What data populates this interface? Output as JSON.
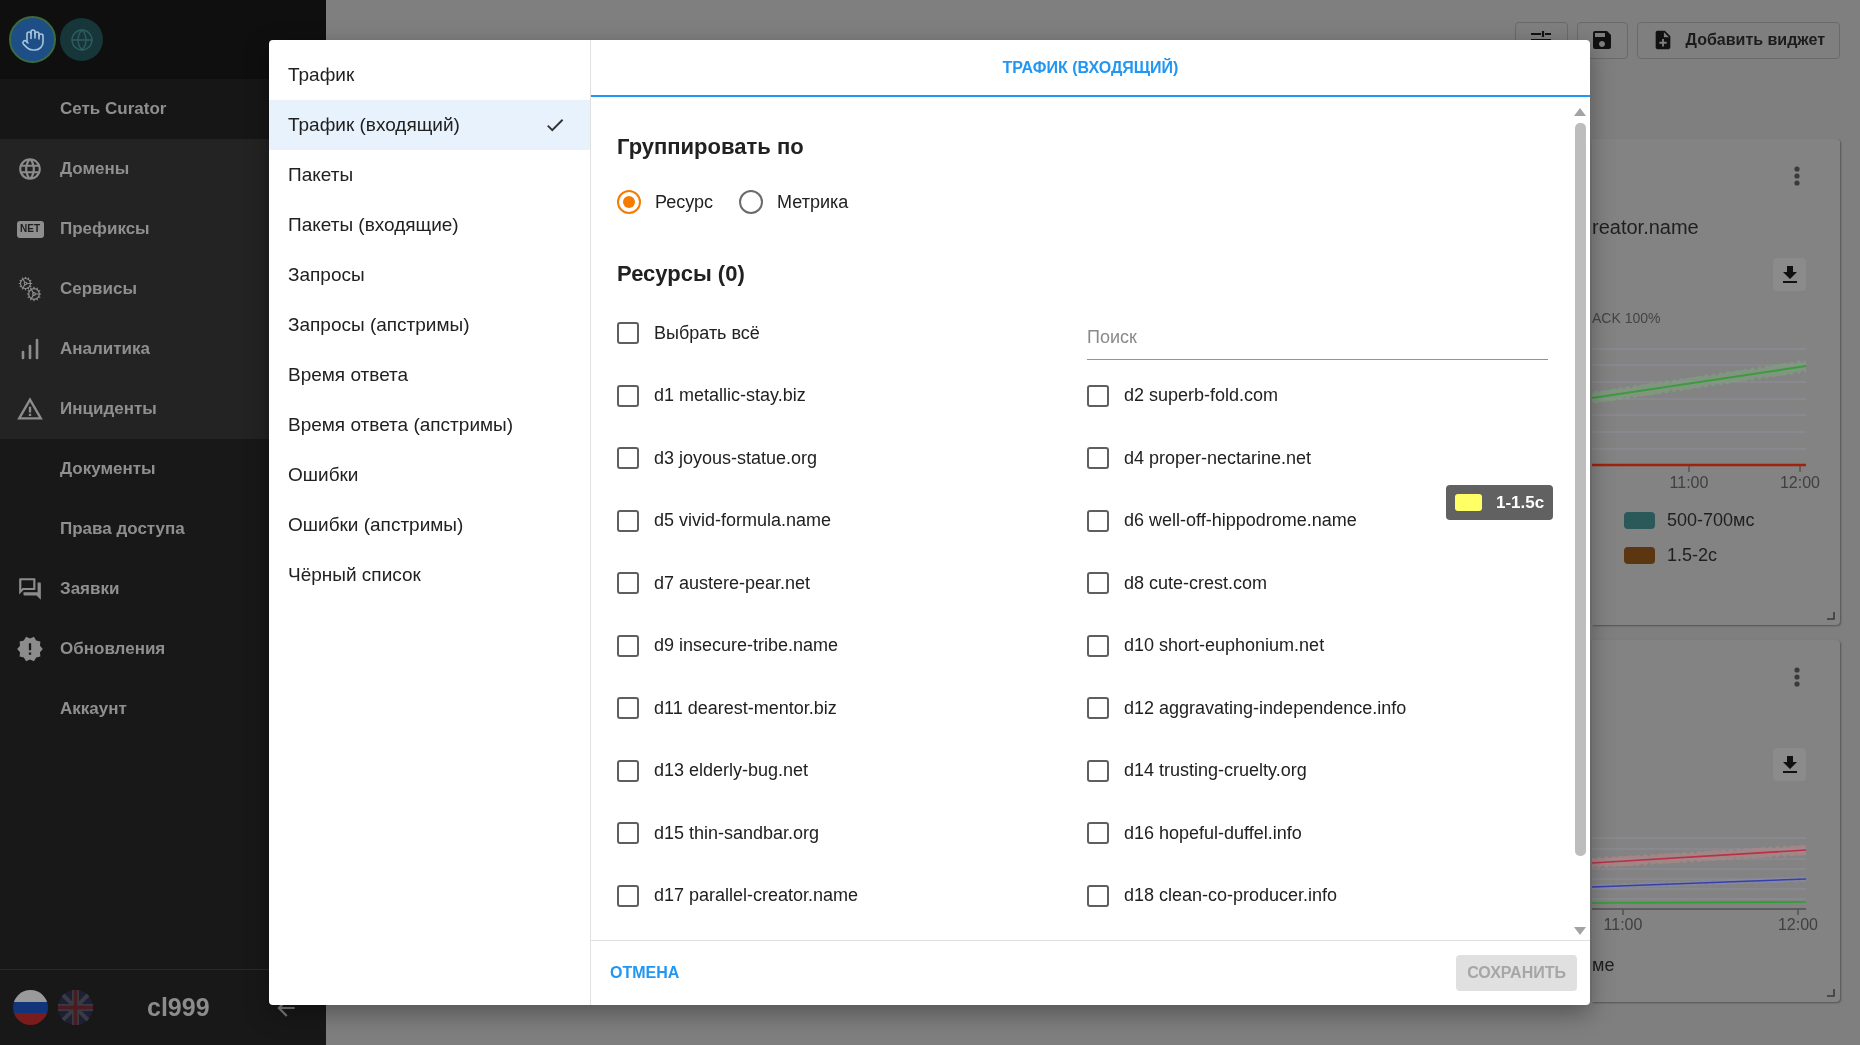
{
  "sidebar": {
    "items": [
      {
        "label": "Сеть Curator",
        "children": [
          {
            "label": "Домены"
          },
          {
            "label": "Префиксы",
            "icon_text": "NET"
          },
          {
            "label": "Сервисы"
          },
          {
            "label": "Аналитика"
          },
          {
            "label": "Инциденты"
          }
        ]
      },
      {
        "label": "Документы"
      },
      {
        "label": "Права доступа"
      },
      {
        "label": "Заявки"
      },
      {
        "label": "Обновления"
      },
      {
        "label": "Аккаунт"
      }
    ],
    "user": "cl999"
  },
  "header": {
    "add_widget": "Добавить виджет"
  },
  "widgets": [
    {
      "title": "reator.name",
      "subtitle": "ACK 100%",
      "x_labels": [
        "11:00",
        "12:00"
      ],
      "legend": [
        {
          "label": "500-700мс",
          "color": "#2b5959"
        },
        {
          "label": "1.5-2с",
          "color": "#5c3511"
        }
      ]
    },
    {
      "x_labels": [
        "11:00",
        "12:00"
      ],
      "footer": "ме"
    }
  ],
  "tooltip": {
    "label": "1-1.5с",
    "color": "#ffff66"
  },
  "dialog": {
    "menu": [
      {
        "label": "Трафик",
        "selected": false
      },
      {
        "label": "Трафик (входящий)",
        "selected": true
      },
      {
        "label": "Пакеты",
        "selected": false
      },
      {
        "label": "Пакеты (входящие)",
        "selected": false
      },
      {
        "label": "Запросы",
        "selected": false
      },
      {
        "label": "Запросы (апстримы)",
        "selected": false
      },
      {
        "label": "Время ответа",
        "selected": false
      },
      {
        "label": "Время ответа (апстримы)",
        "selected": false
      },
      {
        "label": "Ошибки",
        "selected": false
      },
      {
        "label": "Ошибки (апстримы)",
        "selected": false
      },
      {
        "label": "Чёрный список",
        "selected": false
      }
    ],
    "title": "ТРАФИК (ВХОДЯЩИЙ)",
    "group_by": {
      "label": "Группировать по",
      "options": [
        {
          "label": "Ресурс",
          "selected": true
        },
        {
          "label": "Метрика",
          "selected": false
        }
      ]
    },
    "resources": {
      "heading": "Ресурсы (0)",
      "select_all": {
        "label": "Выбрать всё",
        "checked": false
      },
      "search": {
        "placeholder": "Поиск"
      },
      "items": [
        {
          "label": "d1 metallic-stay.biz",
          "checked": false
        },
        {
          "label": "d2 superb-fold.com",
          "checked": false
        },
        {
          "label": "d3 joyous-statue.org",
          "checked": false
        },
        {
          "label": "d4 proper-nectarine.net",
          "checked": false
        },
        {
          "label": "d5 vivid-formula.name",
          "checked": false
        },
        {
          "label": "d6 well-off-hippodrome.name",
          "checked": false
        },
        {
          "label": "d7 austere-pear.net",
          "checked": false
        },
        {
          "label": "d8 cute-crest.com",
          "checked": false
        },
        {
          "label": "d9 insecure-tribe.name",
          "checked": false
        },
        {
          "label": "d10 short-euphonium.net",
          "checked": false
        },
        {
          "label": "d11 dearest-mentor.biz",
          "checked": false
        },
        {
          "label": "d12 aggravating-independence.info",
          "checked": false
        },
        {
          "label": "d13 elderly-bug.net",
          "checked": false
        },
        {
          "label": "d14 trusting-cruelty.org",
          "checked": false
        },
        {
          "label": "d15 thin-sandbar.org",
          "checked": false
        },
        {
          "label": "d16 hopeful-duffel.info",
          "checked": false
        },
        {
          "label": "d17 parallel-creator.name",
          "checked": false
        },
        {
          "label": "d18 clean-co-producer.info",
          "checked": false
        }
      ]
    },
    "buttons": {
      "cancel": "ОТМЕНА",
      "save": {
        "label": "СОХРАНИТЬ",
        "disabled": true
      }
    }
  }
}
